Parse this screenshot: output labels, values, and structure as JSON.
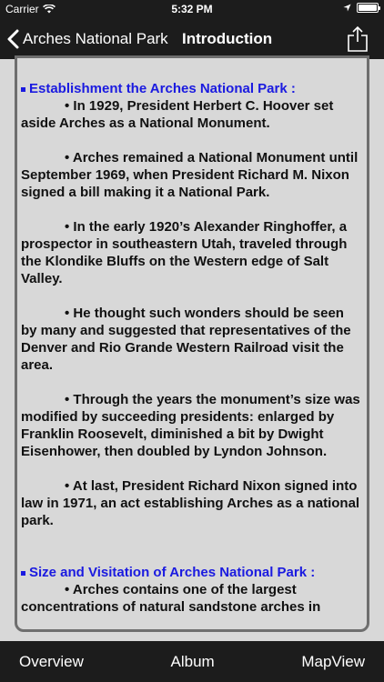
{
  "status_bar": {
    "carrier": "Carrier",
    "time": "5:32 PM"
  },
  "nav": {
    "back_label": "Arches National Park",
    "title": "Introduction"
  },
  "content": {
    "section1_heading": "Establishment the Arches National Park :",
    "paragraphs": [
      "• In 1929, President Herbert C. Hoover set aside Arches as a National Monument.",
      "• Arches remained a National Monument until September 1969, when President Richard M. Nixon signed a bill making it a National Park.",
      "• In the early 1920’s Alexander Ringhoffer, a prospector in southeastern Utah, traveled through the Klondike Bluffs on the Western edge of Salt Valley.",
      "• He thought such wonders should be seen by many and suggested that representatives of the Denver and Rio Grande Western Railroad visit the area.",
      "• Through the years the monument’s size was modified by succeeding presidents: enlarged by Franklin Roosevelt, diminished a bit by Dwight Eisenhower, then doubled by Lyndon Johnson.",
      "• At last, President Richard Nixon signed into law in 1971, an act establishing Arches as a national park."
    ],
    "section2_heading": "Size and Visitation of Arches National Park :",
    "section2_paragraph": "• Arches contains one of the largest concentrations of natural sandstone arches in"
  },
  "tabs": {
    "overview": "Overview",
    "album": "Album",
    "mapview": "MapView"
  },
  "colors": {
    "bar_background": "#1c1c1c",
    "content_background": "#d8d8d8",
    "heading_blue": "#1a1ae0"
  },
  "icons": [
    "wifi-icon",
    "location-arrow-icon",
    "battery-icon",
    "chevron-left-icon",
    "share-icon"
  ]
}
